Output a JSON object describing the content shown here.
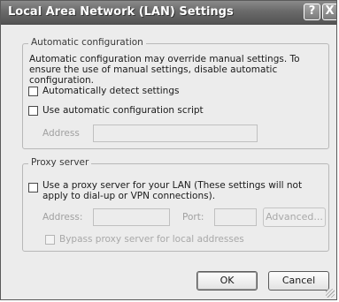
{
  "window": {
    "title": "Local Area Network (LAN) Settings",
    "help_glyph": "?",
    "close_glyph": "X"
  },
  "automatic_configuration": {
    "group_label": "Automatic configuration",
    "description": "Automatic configuration may override manual settings.  To ensure the use of manual settings, disable automatic configuration.",
    "detect_settings": {
      "label": "Automatically detect settings",
      "checked": false
    },
    "use_script": {
      "label": "Use automatic configuration script",
      "checked": false
    },
    "address_label": "Address",
    "address_value": ""
  },
  "proxy_server": {
    "group_label": "Proxy server",
    "use_proxy": {
      "label": "Use a proxy server for your LAN (These settings will not apply to dial-up or VPN connections).",
      "checked": false
    },
    "address_label": "Address:",
    "address_value": "",
    "port_label": "Port:",
    "port_value": "",
    "advanced_label": "Advanced...",
    "bypass": {
      "label": "Bypass proxy server for local addresses",
      "checked": false
    }
  },
  "buttons": {
    "ok_label": "OK",
    "cancel_label": "Cancel"
  },
  "colors": {
    "title_bar": "#6a6a6a",
    "dialog_background": "#ececec",
    "disabled_text": "#a8a8a8"
  }
}
